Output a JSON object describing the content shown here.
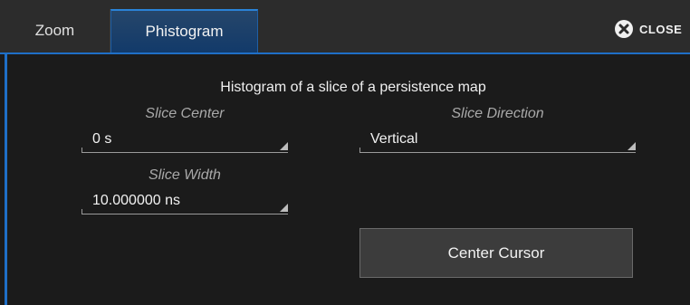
{
  "tabs": {
    "zoom": "Zoom",
    "phistogram": "Phistogram"
  },
  "close_label": "CLOSE",
  "panel": {
    "title": "Histogram of a slice of a persistence map",
    "slice_center": {
      "label": "Slice Center",
      "value": "0 s"
    },
    "slice_direction": {
      "label": "Slice Direction",
      "value": "Vertical"
    },
    "slice_width": {
      "label": "Slice Width",
      "value": "10.000000 ns"
    },
    "center_cursor_label": "Center Cursor"
  },
  "icons": {
    "close": "close-icon",
    "dropdown": "dropdown-arrow-icon"
  },
  "colors": {
    "accent": "#1f6fc7",
    "active_tab": "#1a3f6a",
    "background": "#1b1b1b",
    "tabbar": "#2c2c2c"
  }
}
